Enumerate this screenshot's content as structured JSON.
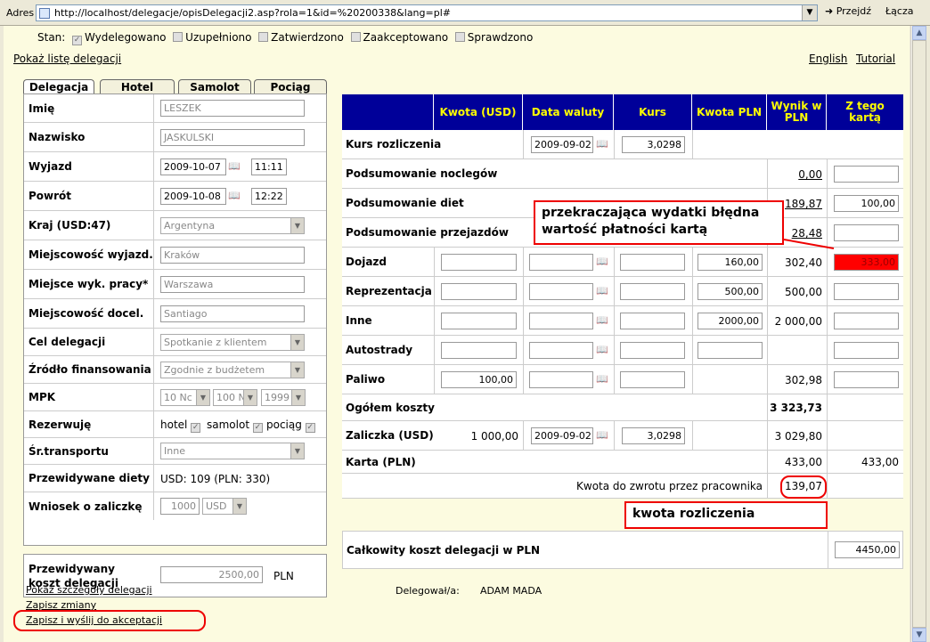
{
  "browser": {
    "address_label": "Adres",
    "url": "http://localhost/delegacje/opisDelegacji2.asp?rola=1&id=%20200338&lang=pl#",
    "go_label": "Przejdź",
    "links_label": "Łącza"
  },
  "status": {
    "label": "Stan:",
    "items": [
      {
        "label": "Wydelegowano",
        "checked": true
      },
      {
        "label": "Uzupełniono",
        "checked": false
      },
      {
        "label": "Zatwierdzono",
        "checked": false
      },
      {
        "label": "Zaakceptowano",
        "checked": false
      },
      {
        "label": "Sprawdzono",
        "checked": false
      }
    ]
  },
  "links": {
    "show_list": "Pokaż listę delegacji",
    "english": "English",
    "tutorial": "Tutorial",
    "show_details": "Pokaż szczegóły delegacji",
    "save_changes": "Zapisz zmiany",
    "save_send": "Zapisz i wyślij do akceptacji"
  },
  "tabs": [
    "Delegacja",
    "Hotel",
    "Samolot",
    "Pociąg"
  ],
  "form": {
    "imie": {
      "label": "Imię",
      "value": "LESZEK"
    },
    "nazwisko": {
      "label": "Nazwisko",
      "value": "JASKULSKI"
    },
    "wyjazd": {
      "label": "Wyjazd",
      "date": "2009-10-07",
      "time": "11:11"
    },
    "powrot": {
      "label": "Powrót",
      "date": "2009-10-08",
      "time": "12:22"
    },
    "kraj": {
      "label": "Kraj (USD:47)",
      "value": "Argentyna"
    },
    "miejsc_wyjazdu": {
      "label": "Miejscowość wyjazd.",
      "value": "Kraków"
    },
    "miejsce_pracy": {
      "label": "Miejsce wyk. pracy*",
      "value": "Warszawa"
    },
    "miejsc_docel": {
      "label": "Miejscowość docel.",
      "value": "Santiago"
    },
    "cel": {
      "label": "Cel delegacji",
      "value": "Spotkanie z klientem"
    },
    "zrodlo": {
      "label": "Źródło finansowania",
      "value": "Zgodnie z budżetem"
    },
    "mpk": {
      "label": "MPK",
      "v1": "10 Nc",
      "v2": "100 N",
      "v3": "1999"
    },
    "rezerwuje": {
      "label": "Rezerwuję",
      "opts": [
        "hotel",
        "samolot",
        "pociąg"
      ]
    },
    "transport": {
      "label": "Śr.transportu",
      "value": "Inne"
    },
    "diety": {
      "label": "Przewidywane diety",
      "value": "USD: 109 (PLN: 330)"
    },
    "zaliczka": {
      "label": "Wniosek o zaliczkę",
      "amount": "1000",
      "currency": "USD"
    },
    "koszt": {
      "label1": "Przewidywany",
      "label2": "koszt delegacji",
      "value": "2500,00",
      "unit": "PLN"
    }
  },
  "table": {
    "headers": [
      "Kwota (USD)",
      "Data waluty",
      "Kurs",
      "Kwota PLN",
      "Wynik w PLN",
      "Z tego kartą"
    ],
    "kurs_rozl": {
      "label": "Kurs rozliczenia",
      "date": "2009-09-02",
      "rate": "3,0298"
    },
    "noclegi": {
      "label": "Podsumowanie noclegów",
      "wynik": "0,00",
      "karta": ""
    },
    "diety": {
      "label": "Podsumowanie diet",
      "wynik": "189,87",
      "karta": "100,00"
    },
    "przejazdy": {
      "label": "Podsumowanie przejazdów",
      "wynik": "28,48",
      "karta": ""
    },
    "dojazd": {
      "label": "Dojazd",
      "pln": "160,00",
      "wynik": "302,40",
      "karta": "333,00"
    },
    "repr": {
      "label": "Reprezentacja",
      "pln": "500,00",
      "wynik": "500,00",
      "karta": ""
    },
    "inne": {
      "label": "Inne",
      "pln": "2000,00",
      "wynik": "2 000,00",
      "karta": ""
    },
    "autostrady": {
      "label": "Autostrady",
      "pln": "",
      "wynik": "",
      "karta": ""
    },
    "paliwo": {
      "label": "Paliwo",
      "usd": "100,00",
      "wynik": "302,98",
      "karta": ""
    },
    "ogolem": {
      "label": "Ogółem koszty",
      "wynik": "3 323,73"
    },
    "zaliczka": {
      "label": "Zaliczka (USD)",
      "usd": "1 000,00",
      "date": "2009-09-02",
      "rate": "3,0298",
      "wynik": "3 029,80"
    },
    "karta": {
      "label": "Karta (PLN)",
      "wynik": "433,00",
      "karta": "433,00"
    },
    "zwrot": {
      "label": "Kwota do zwrotu przez pracownika",
      "value": "139,07"
    },
    "calkowity": {
      "label": "Całkowity koszt delegacji w PLN",
      "value": "4450,00"
    }
  },
  "delegowal": {
    "label": "Delegował/a:",
    "value": "ADAM MADA"
  },
  "callouts": {
    "error": "przekraczająca wydatki błędna wartość płatności kartą",
    "kwota": "kwota rozliczenia"
  },
  "colors": {
    "header_bg": "#000099",
    "header_text": "#ffff00",
    "error_bg": "#ff0000",
    "callout_border": "#ee0000",
    "page_bg": "#fcfbe0"
  }
}
